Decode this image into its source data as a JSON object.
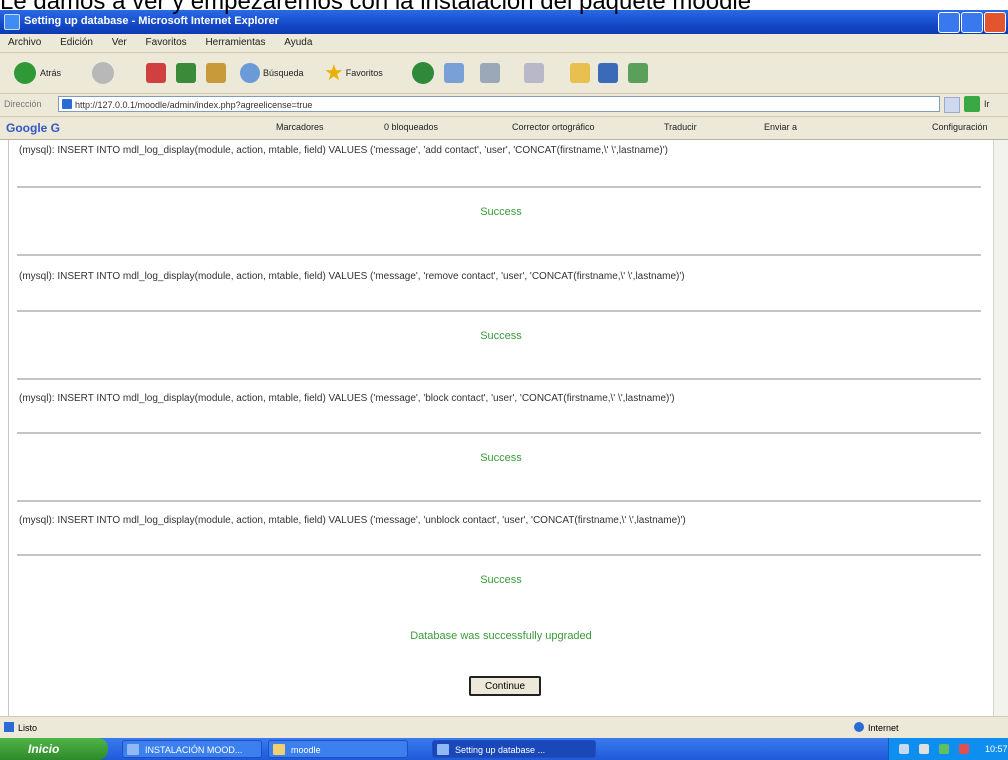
{
  "overlay_caption": "Le damos a ver y empezaremos con la instalación del paquete moodle",
  "window": {
    "title": "Setting up database - Microsoft Internet Explorer"
  },
  "menu": [
    "Archivo",
    "Edición",
    "Ver",
    "Favoritos",
    "Herramientas",
    "Ayuda"
  ],
  "toolbar": {
    "back_label": "Atrás",
    "search_label": "Búsqueda",
    "favorites_label": "Favoritos"
  },
  "address": {
    "label": "Dirección",
    "url": "http://127.0.0.1/moodle/admin/index.php?agreelicense=true",
    "go_label": "Ir"
  },
  "google_bar": {
    "logo": "Google G",
    "bookmarks": "Marcadores",
    "blocked": "0 bloqueados",
    "spellcheck": "Corrector ortográfico",
    "translate": "Traducir",
    "send": "Enviar a",
    "settings": "Configuración"
  },
  "entries": [
    {
      "sql": "(mysql): INSERT INTO mdl_log_display(module, action, mtable, field) VALUES ('message', 'add contact', 'user', 'CONCAT(firstname,\\' \\',lastname)')",
      "status": "Success"
    },
    {
      "sql": "(mysql): INSERT INTO mdl_log_display(module, action, mtable, field) VALUES ('message', 'remove contact', 'user', 'CONCAT(firstname,\\' \\',lastname)')",
      "status": "Success"
    },
    {
      "sql": "(mysql): INSERT INTO mdl_log_display(module, action, mtable, field) VALUES ('message', 'block contact', 'user', 'CONCAT(firstname,\\' \\',lastname)')",
      "status": "Success"
    },
    {
      "sql": "(mysql): INSERT INTO mdl_log_display(module, action, mtable, field) VALUES ('message', 'unblock contact', 'user', 'CONCAT(firstname,\\' \\',lastname)')",
      "status": "Success"
    }
  ],
  "upgraded_message": "Database was successfully upgraded",
  "continue_label": "Continue",
  "statusbar": {
    "left": "Listo",
    "zone": "Internet"
  },
  "taskbar": {
    "start": "Inicio",
    "tasks": [
      "INSTALACIÓN MOOD...",
      "moodle",
      "Setting up database ..."
    ],
    "clock": "10:57"
  },
  "colors": {
    "success": "#3a9a3a",
    "titlebar": "#1549c8"
  }
}
